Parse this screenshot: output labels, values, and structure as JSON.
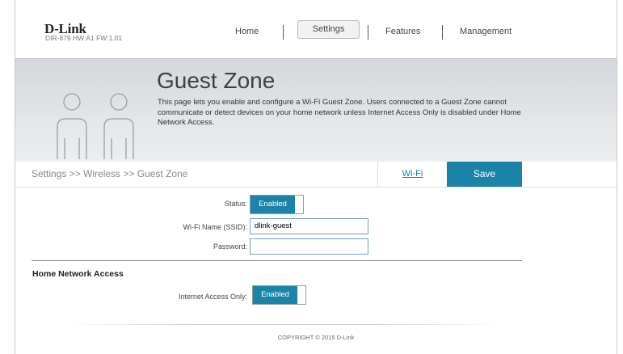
{
  "header": {
    "logo": "D-Link",
    "model": "DIR-879 HW:A1 FW:1.01",
    "nav": {
      "home": "Home",
      "settings": "Settings",
      "features": "Features",
      "management": "Management"
    }
  },
  "hero": {
    "title": "Guest Zone",
    "description": "This page lets you enable and configure a Wi-Fi Guest Zone. Users connected to a Guest Zone cannot communicate or detect devices on your home network unless Internet Access Only is disabled under Home Network Access.",
    "icon": "two-people-icon"
  },
  "breadcrumb": {
    "path": "Settings >> Wireless >> Guest Zone",
    "wifi_link": "Wi-Fi",
    "save_label": "Save"
  },
  "form": {
    "status_label": "Status:",
    "status_value": "Enabled",
    "ssid_label": "Wi-Fi Name (SSID):",
    "ssid_value": "dlink-guest",
    "password_label": "Password:",
    "password_value": ""
  },
  "home_network": {
    "title": "Home Network Access",
    "internet_only_label": "Internet Access Only:",
    "internet_only_value": "Enabled"
  },
  "footer": {
    "copyright": "COPYRIGHT © 2015 D-Link"
  },
  "colors": {
    "accent": "#1c83a8",
    "link": "#1a7ba6"
  }
}
